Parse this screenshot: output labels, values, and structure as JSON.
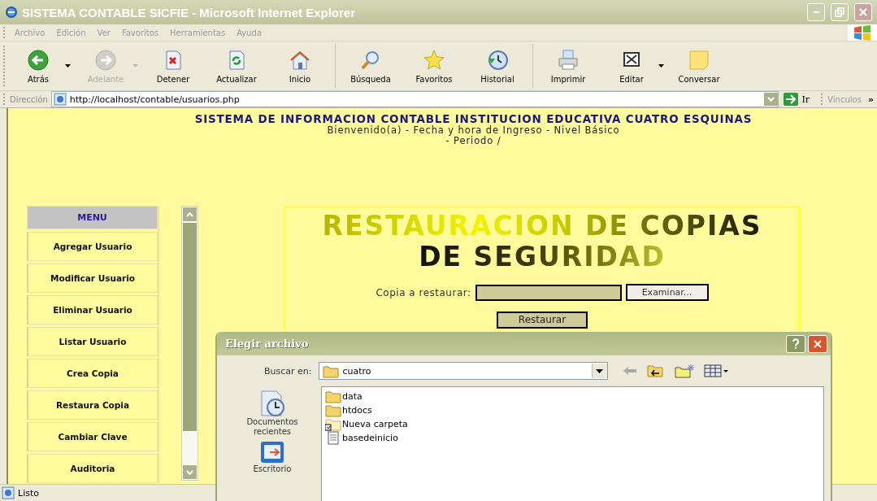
{
  "window": {
    "title": "SISTEMA CONTABLE SICFIE - Microsoft Internet Explorer",
    "active": false
  },
  "menu_bar": [
    "Archivo",
    "Edición",
    "Ver",
    "Favoritos",
    "Herramientas",
    "Ayuda"
  ],
  "toolbar_groups": [
    {
      "buttons": [
        {
          "label": "Atrás",
          "kind": "back",
          "disabled": false,
          "dropdown": true
        },
        {
          "label": "Adelante",
          "kind": "forward",
          "disabled": true,
          "dropdown": true
        },
        {
          "label": "Detener",
          "kind": "stop",
          "disabled": false,
          "dropdown": false
        },
        {
          "label": "Actualizar",
          "kind": "refresh",
          "disabled": false,
          "dropdown": false
        },
        {
          "label": "Inicio",
          "kind": "home",
          "disabled": false,
          "dropdown": false
        }
      ]
    },
    {
      "buttons": [
        {
          "label": "Búsqueda",
          "kind": "search",
          "disabled": false,
          "dropdown": false
        },
        {
          "label": "Favoritos",
          "kind": "favorites",
          "disabled": false,
          "dropdown": false
        },
        {
          "label": "Historial",
          "kind": "history",
          "disabled": false,
          "dropdown": false
        }
      ]
    },
    {
      "buttons": [
        {
          "label": "Imprimir",
          "kind": "print",
          "disabled": false,
          "dropdown": false
        },
        {
          "label": "Editar",
          "kind": "edit",
          "disabled": false,
          "dropdown": true
        },
        {
          "label": "Conversar",
          "kind": "note",
          "disabled": false,
          "dropdown": false
        }
      ]
    }
  ],
  "address_bar": {
    "label": "Dirección",
    "url": "http://localhost/contable/usuarios.php",
    "go_label": "Ir",
    "links_label": "Vínculos",
    "more": "»"
  },
  "page": {
    "heading": "SISTEMA DE INFORMACION CONTABLE INSTITUCION EDUCATIVA CUATRO ESQUINAS",
    "welcome": "Bienvenido(a) - Fecha y hora de Ingreso - Nivel Básico",
    "period": "- Periodo /",
    "menu": {
      "title": "MENU",
      "items": [
        "Agregar Usuario",
        "Modificar Usuario",
        "Eliminar Usuario",
        "Listar Usuario",
        "Crea Copia",
        "Restaura Copia",
        "Cambiar Clave",
        "Auditoria"
      ]
    },
    "panel": {
      "title_lines": [
        "RESTAURACION DE COPIAS",
        "DE SEGURIDAD"
      ],
      "field_label": "Copia a restaurar:",
      "browse_button": "Examinar...",
      "submit_button": "Restaurar"
    }
  },
  "status_bar": {
    "text": "Listo"
  },
  "dialog": {
    "title": "Elegir archivo",
    "look_in_label": "Buscar en:",
    "look_in_value": "cuatro",
    "places": [
      {
        "label": "Documentos recientes",
        "kind": "recent"
      },
      {
        "label": "Escritorio",
        "kind": "desktop"
      }
    ],
    "files": [
      {
        "name": "data",
        "kind": "folder"
      },
      {
        "name": "htdocs",
        "kind": "folder"
      },
      {
        "name": "Nueva carpeta",
        "kind": "shortcut"
      },
      {
        "name": "basedeinicio",
        "kind": "file"
      }
    ]
  }
}
